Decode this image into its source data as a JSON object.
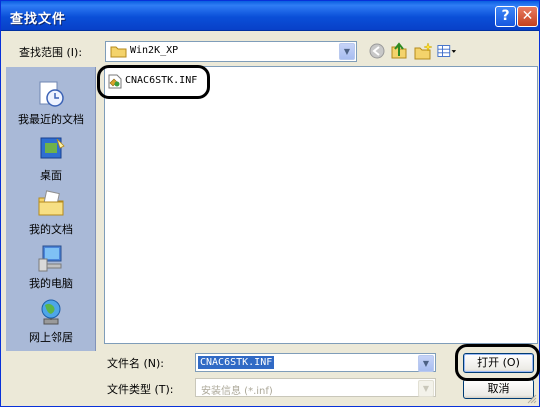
{
  "window": {
    "title": "查找文件",
    "help_glyph": "?",
    "close_glyph": "✕"
  },
  "lookin": {
    "label": "查找范围 (I):",
    "value": "Win2K_XP"
  },
  "places": [
    {
      "label": "我最近的文档",
      "icon": "recent-documents-icon"
    },
    {
      "label": "桌面",
      "icon": "desktop-icon"
    },
    {
      "label": "我的文档",
      "icon": "my-documents-icon"
    },
    {
      "label": "我的电脑",
      "icon": "my-computer-icon"
    },
    {
      "label": "网上邻居",
      "icon": "network-places-icon"
    }
  ],
  "files": [
    {
      "name": "CNAC6STK.INF",
      "icon": "inf-file-icon"
    }
  ],
  "filename": {
    "label": "文件名 (N):",
    "value": "CNAC6STK.INF"
  },
  "filetype": {
    "label": "文件类型 (T):",
    "value": "安装信息 (*.inf)"
  },
  "buttons": {
    "open": "打开 (O)",
    "cancel": "取消"
  },
  "colors": {
    "titlebar": "#0a4fd8",
    "places_bar": "#a9b9d7",
    "selection": "#316ac5",
    "face": "#ece9d8"
  }
}
